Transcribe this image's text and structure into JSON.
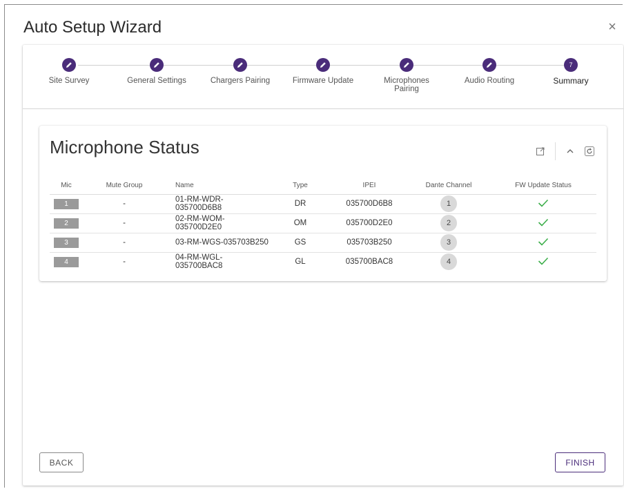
{
  "window": {
    "title": "Auto Setup Wizard",
    "close_icon": "close-icon"
  },
  "stepper": {
    "steps": [
      {
        "label": "Site Survey",
        "state": "done",
        "icon": "pencil-icon"
      },
      {
        "label": "General Settings",
        "state": "done",
        "icon": "pencil-icon"
      },
      {
        "label": "Chargers Pairing",
        "state": "done",
        "icon": "pencil-icon"
      },
      {
        "label": "Firmware Update",
        "state": "done",
        "icon": "pencil-icon"
      },
      {
        "label": "Microphones Pairing",
        "state": "done",
        "icon": "pencil-icon"
      },
      {
        "label": "Audio Routing",
        "state": "done",
        "icon": "pencil-icon"
      },
      {
        "label": "Summary",
        "state": "active",
        "number": "7"
      }
    ],
    "accent": "#4a2c7a"
  },
  "panel": {
    "title": "Microphone Status",
    "icons": [
      "external-link-icon",
      "collapse-icon",
      "refresh-icon"
    ],
    "columns": [
      "Mic",
      "Mute Group",
      "Name",
      "Type",
      "IPEI",
      "Dante Channel",
      "FW Update Status"
    ],
    "rows": [
      {
        "mic": "1",
        "mute_group": "-",
        "name": "01-RM-WDR-035700D6B8",
        "type": "DR",
        "ipei": "035700D6B8",
        "dante": "1",
        "fw_status": "check-icon"
      },
      {
        "mic": "2",
        "mute_group": "-",
        "name": "02-RM-WOM-035700D2E0",
        "type": "OM",
        "ipei": "035700D2E0",
        "dante": "2",
        "fw_status": "check-icon"
      },
      {
        "mic": "3",
        "mute_group": "-",
        "name": "03-RM-WGS-035703B250",
        "type": "GS",
        "ipei": "035703B250",
        "dante": "3",
        "fw_status": "check-icon"
      },
      {
        "mic": "4",
        "mute_group": "-",
        "name": "04-RM-WGL-035700BAC8",
        "type": "GL",
        "ipei": "035700BAC8",
        "dante": "4",
        "fw_status": "check-icon"
      }
    ],
    "check_color": "#3cae4a"
  },
  "footer": {
    "back_label": "BACK",
    "finish_label": "FINISH"
  }
}
